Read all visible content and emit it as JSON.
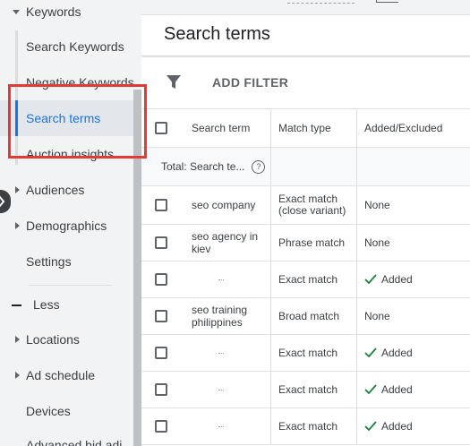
{
  "sidebar": {
    "keywords_group": "Keywords",
    "items": [
      {
        "label": "Search Keywords"
      },
      {
        "label": "Negative Keywords"
      },
      {
        "label": "Search terms"
      },
      {
        "label": "Auction insights"
      }
    ],
    "audiences": "Audiences",
    "demographics": "Demographics",
    "settings": "Settings",
    "less": "Less",
    "locations": "Locations",
    "ad_schedule": "Ad schedule",
    "devices": "Devices",
    "advanced": "Advanced bid adj."
  },
  "page": {
    "title": "Search terms",
    "add_filter": "ADD FILTER"
  },
  "table": {
    "headers": {
      "term": "Search term",
      "match": "Match type",
      "added": "Added/Excluded"
    },
    "total": "Total: Search te...",
    "rows": [
      {
        "term": "seo company",
        "match": "Exact match (close variant)",
        "status": "None"
      },
      {
        "term": "seo agency in kiev",
        "match": "Phrase match",
        "status": "None"
      },
      {
        "term": "",
        "match": "Exact match",
        "status": "Added"
      },
      {
        "term": "seo training philippines",
        "match": "Broad match",
        "status": "None"
      },
      {
        "term": "",
        "match": "Exact match",
        "status": "Added"
      },
      {
        "term": "",
        "match": "Exact match",
        "status": "Added"
      },
      {
        "term": "",
        "match": "Exact match",
        "status": "Added"
      }
    ]
  },
  "colors": {
    "accent": "#1a73e8",
    "added_check": "#188038",
    "highlight": "#e53935"
  }
}
